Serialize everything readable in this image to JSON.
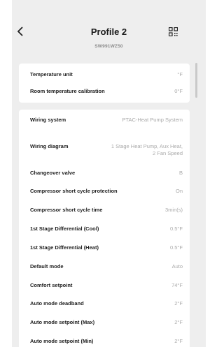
{
  "header": {
    "title": "Profile 2",
    "subtitle": "SW991WZ50",
    "back_icon": "chevron-left-icon",
    "qr_icon": "qr-code-icon"
  },
  "card1": {
    "rows": [
      {
        "label": "Temperature unit",
        "value": "°F"
      },
      {
        "label": "Room temperature calibration",
        "value": "0°F"
      }
    ]
  },
  "card2": {
    "rows": [
      {
        "label": "Wiring system",
        "value": "PTAC-Heat Pump System"
      },
      {
        "label": "Wiring diagram",
        "value": "1 Stage Heat Pump, Aux Heat, 2 Fan Speed"
      },
      {
        "label": "Changeover valve",
        "value": "B"
      },
      {
        "label": "Compressor short cycle protection",
        "value": "On"
      },
      {
        "label": "Compressor short cycle time",
        "value": "3min(s)"
      },
      {
        "label": "1st Stage Differential (Cool)",
        "value": "0.5°F"
      },
      {
        "label": "1st Stage Differential (Heat)",
        "value": "0.5°F"
      },
      {
        "label": "Default mode",
        "value": "Auto"
      },
      {
        "label": "Comfort setpoint",
        "value": "74°F"
      },
      {
        "label": "Auto mode deadband",
        "value": "2°F"
      },
      {
        "label": "Auto mode setpoint (Max)",
        "value": "2°F"
      },
      {
        "label": "Auto mode setpoint (Min)",
        "value": "2°F"
      }
    ]
  },
  "colors": {
    "background": "#eeeeee",
    "card": "#ffffff",
    "value_text": "#a9a9a9"
  }
}
